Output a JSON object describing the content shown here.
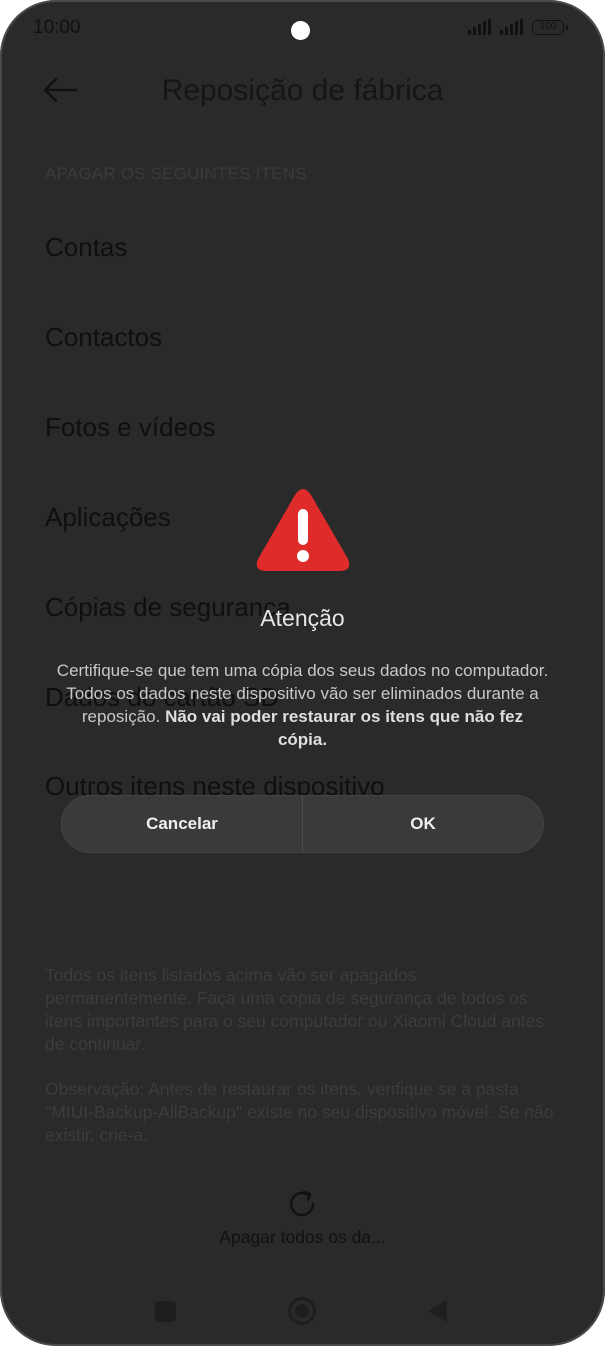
{
  "status_bar": {
    "time": "10:00",
    "battery": "100"
  },
  "header": {
    "title": "Reposição de fábrica"
  },
  "section_header": "APAGAR OS SEGUINTES ITENS",
  "items": [
    "Contas",
    "Contactos",
    "Fotos e vídeos",
    "Aplicações",
    "Cópias de segurança",
    "Dados do cartão SD",
    "Outros itens neste dispositivo"
  ],
  "notes": {
    "warning": "Todos os itens listados acima vão ser apagados permanentemente. Faça uma cópia de segurança de todos os itens importantes para o seu computador ou Xiaomi Cloud antes de continuar.",
    "observation": "Observação: Antes de restaurar os itens, verifique se a pasta \"MIUI-Backup-AllBackup\" existe no seu dispositivo móvel. Se não existir, crie-a."
  },
  "erase_button": {
    "label": "Apagar todos os da..."
  },
  "dialog": {
    "title": "Atenção",
    "message": "Certifique-se que tem uma cópia dos seus dados no computador. Todos os dados neste dispositivo vão ser eliminados durante a reposição.",
    "message_bold": "Não vai poder restaurar os itens que não fez cópia.",
    "cancel_label": "Cancelar",
    "ok_label": "OK"
  },
  "colors": {
    "overlay": "#2a2a2a",
    "warning_red": "#e02b2b",
    "dialog_button_bg": "#3a3a3a"
  }
}
